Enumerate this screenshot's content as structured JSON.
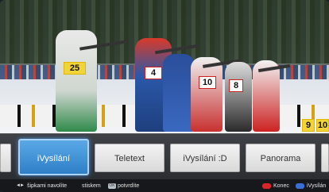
{
  "video": {
    "bibs": [
      "25",
      "4",
      "10",
      "8",
      "9",
      "10"
    ]
  },
  "menu": {
    "items": [
      {
        "label": ""
      },
      {
        "label": "iVysílání"
      },
      {
        "label": "Teletext"
      },
      {
        "label": "iVysílání :D"
      },
      {
        "label": "Panorama"
      },
      {
        "label": ""
      }
    ],
    "selected_index": 1
  },
  "hints": {
    "navigate_arrows": "◄►",
    "navigate": "šipkami navolíte",
    "confirm_prefix": "stiskem",
    "ok_key": "OK",
    "confirm": "potvrdíte",
    "end_label": "Konec",
    "ivysilani_label": "iVysílán"
  },
  "colors": {
    "selected": "#2f7fc8",
    "red_key": "#d9242a",
    "blue_key": "#3a6fd8"
  }
}
